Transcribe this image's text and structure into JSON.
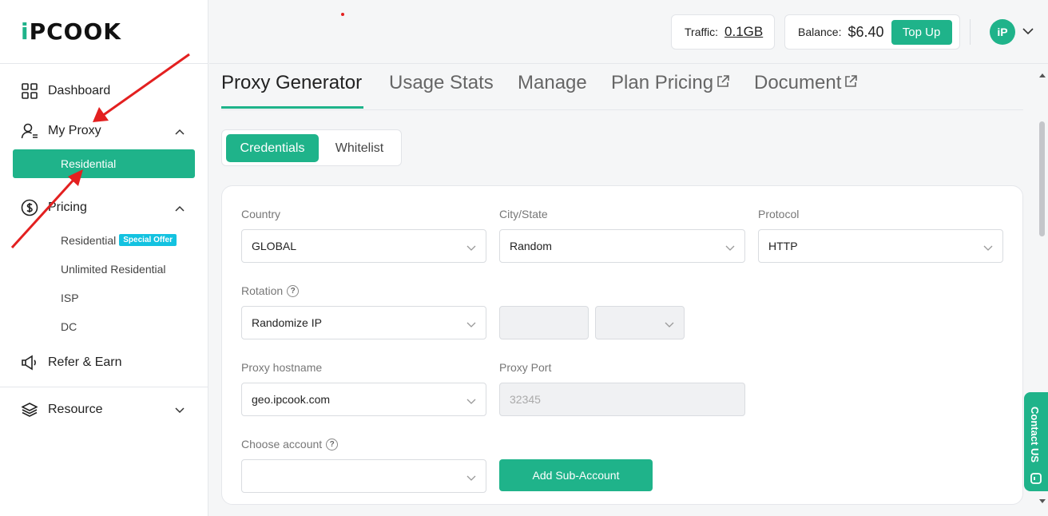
{
  "logo": {
    "text_a": "i",
    "text_b": "PCOOK"
  },
  "sidebar": {
    "dashboard": "Dashboard",
    "my_proxy": "My Proxy",
    "residential": "Residential",
    "pricing": "Pricing",
    "pricing_items": [
      {
        "label": "Residential",
        "badge": "Special Offer"
      },
      {
        "label": "Unlimited Residential"
      },
      {
        "label": "ISP"
      },
      {
        "label": "DC"
      }
    ],
    "refer": "Refer & Earn",
    "resource": "Resource"
  },
  "topbar": {
    "traffic_label": "Traffic:",
    "traffic_value": "0.1GB",
    "balance_label": "Balance:",
    "balance_value": "$6.40",
    "topup": "Top Up",
    "avatar": "iP"
  },
  "tabs": [
    "Proxy Generator",
    "Usage Stats",
    "Manage",
    "Plan Pricing",
    "Document"
  ],
  "mode": {
    "credentials": "Credentials",
    "whitelist": "Whitelist"
  },
  "form": {
    "country_label": "Country",
    "country_value": "GLOBAL",
    "city_label": "City/State",
    "city_value": "Random",
    "protocol_label": "Protocol",
    "protocol_value": "HTTP",
    "rotation_label": "Rotation",
    "rotation_value": "Randomize IP",
    "hostname_label": "Proxy hostname",
    "hostname_value": "geo.ipcook.com",
    "port_label": "Proxy Port",
    "port_value": "32345",
    "account_label": "Choose account",
    "add_sub": "Add Sub-Account"
  },
  "contact": "Contact US",
  "colors": {
    "accent": "#1fb38a",
    "badge": "#13c2e0",
    "annotation": "#e32020"
  }
}
